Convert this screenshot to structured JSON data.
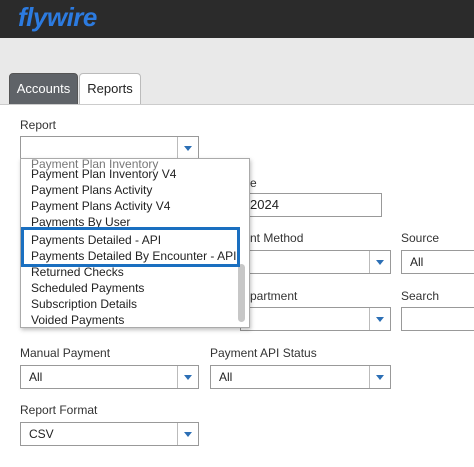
{
  "brand": {
    "name": "flywire",
    "color": "#2c7be0"
  },
  "tabs": [
    {
      "label": "Accounts",
      "active": true
    },
    {
      "label": "Reports",
      "active": false
    }
  ],
  "form": {
    "report_label": "Report",
    "report_value": "",
    "date_label_fragment": "e",
    "date_value_fragment": "2024",
    "payment_method_label_fragment": "nt Method",
    "payment_method_value": "",
    "source_label": "Source",
    "source_value": "All",
    "department_label_fragment": "partment",
    "department_value": "",
    "search_label": "Search",
    "search_value": "",
    "manual_payment_label": "Manual Payment",
    "manual_payment_value": "All",
    "payment_api_status_label": "Payment API Status",
    "payment_api_status_value": "All",
    "report_format_label": "Report Format",
    "report_format_value": "CSV"
  },
  "dropdown": {
    "items": [
      "Payment Plan Inventory V4",
      "Payment Plans Activity",
      "Payment Plans Activity V4",
      "Payments By User",
      "Payments Detailed - API",
      "Payments Detailed By Encounter - API",
      "Returned Checks",
      "Scheduled Payments",
      "Subscription Details",
      "Voided Payments"
    ],
    "highlight_color": "#1a6fc0"
  }
}
